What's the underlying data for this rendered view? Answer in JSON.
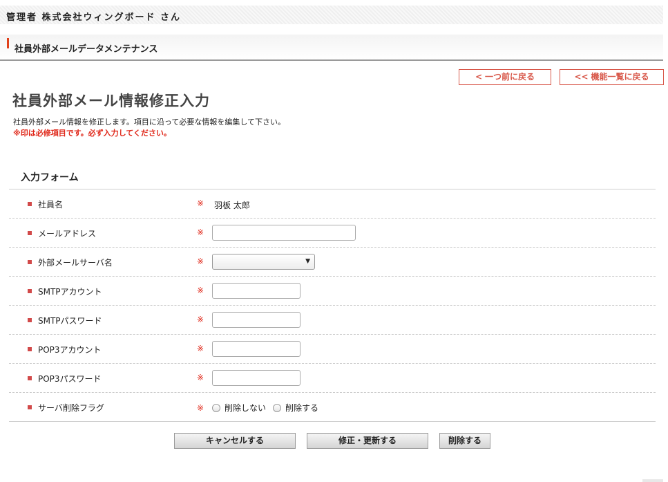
{
  "header": {
    "user_name": "管理者 株式会社ウィングボード さん"
  },
  "section": {
    "title": "社員外部メールデータメンテナンス"
  },
  "nav": {
    "back_label": "一つ前に戻る",
    "list_label": "機能一覧に戻る",
    "back_icon": "<",
    "list_icon": "<<",
    "accent_color": "#d8584a"
  },
  "page": {
    "title": "社員外部メール情報修正入力",
    "description": "社員外部メール情報を修正します。項目に沿って必要な情報を編集して下さい。",
    "required_note": "※印は必修項目です。必ず入力してください。"
  },
  "form": {
    "heading": "入力フォーム",
    "required_mark": "※",
    "fields": {
      "employee_name": {
        "label": "社員名",
        "value": "羽板 太郎"
      },
      "email": {
        "label": "メールアドレス",
        "value": ""
      },
      "mail_server": {
        "label": "外部メールサーバ名",
        "selected": ""
      },
      "smtp_account": {
        "label": "SMTPアカウント",
        "value": ""
      },
      "smtp_password": {
        "label": "SMTPパスワード",
        "value": ""
      },
      "pop3_account": {
        "label": "POP3アカウント",
        "value": ""
      },
      "pop3_password": {
        "label": "POP3パスワード",
        "value": ""
      },
      "server_delete_flag": {
        "label": "サーバ削除フラグ",
        "options": [
          "削除しない",
          "削除する"
        ]
      }
    }
  },
  "actions": {
    "cancel_label": "キャンセルする",
    "update_label": "修正・更新する",
    "delete_label": "削除する"
  }
}
